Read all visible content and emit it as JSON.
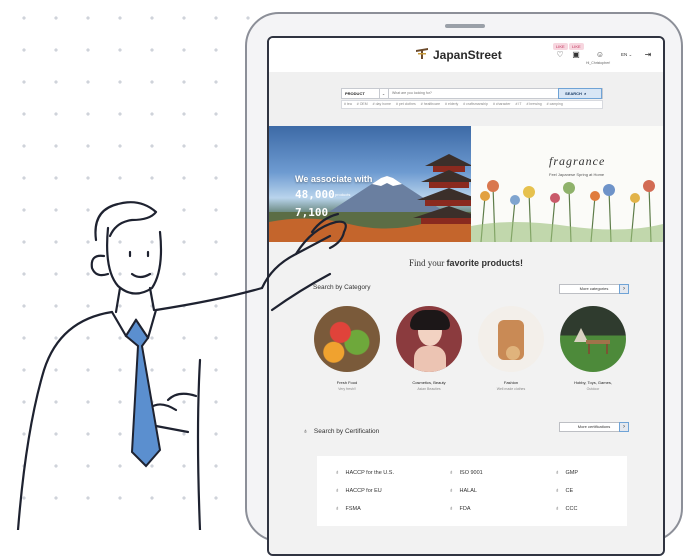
{
  "header": {
    "logo": "JapanStreet",
    "badges": [
      "LIKE",
      "LIKE"
    ],
    "user_label": "Hi_Christopher!",
    "lang": "EN"
  },
  "search": {
    "category": "PRODUCT",
    "placeholder": "What are you looking for?",
    "button": "SEARCH",
    "tags": [
      "# tea",
      "# OEM",
      "# day home",
      "# pet clothes",
      "# healthcare",
      "# elderly",
      "# craftsmanship",
      "# character",
      "# IT",
      "# brewing",
      "# camping"
    ]
  },
  "hero": {
    "left_title": "We associate with",
    "left_num1": "48,000",
    "left_num1_label": "products",
    "left_num2": "7,100",
    "right_title": "fragrance",
    "right_sub": "Feel Japanese Spring at Home"
  },
  "find": {
    "prefix": "Find your",
    "bold": "favorite products!"
  },
  "categories": {
    "title": "Search by Category",
    "more": "More categories",
    "items": [
      {
        "name": "Fresh Food",
        "sub": "Very fresh!!"
      },
      {
        "name": "Cosmetics, Beauty",
        "sub": "Asian Beauties"
      },
      {
        "name": "Fashion",
        "sub": "Well made clothes"
      },
      {
        "name": "Hobby, Toys, Games,",
        "sub": "Outdoor"
      }
    ]
  },
  "certs": {
    "title": "Search by Certification",
    "more": "More certifications",
    "items": [
      "HACCP for the U.S.",
      "ISO 9001",
      "GMP",
      "HACCP for EU",
      "HALAL",
      "CE",
      "FSMA",
      "FDA",
      "CCC"
    ]
  },
  "colors": {
    "accent": "#6fa3d6",
    "badge": "#c2305a",
    "frame": "#303441"
  }
}
